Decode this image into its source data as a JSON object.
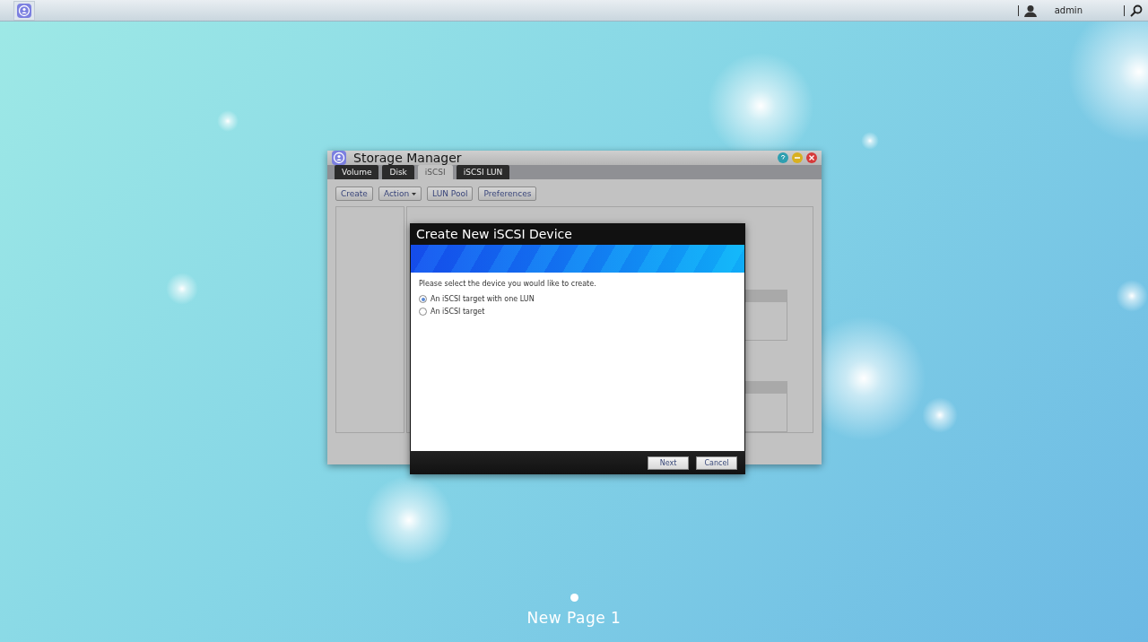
{
  "top_bar": {
    "user": "admin"
  },
  "window": {
    "title": "Storage Manager",
    "tabs": [
      {
        "label": "Volume",
        "selected": false
      },
      {
        "label": "Disk",
        "selected": false
      },
      {
        "label": "iSCSI",
        "selected": true
      },
      {
        "label": "iSCSI LUN",
        "selected": false
      }
    ],
    "toolbar": [
      {
        "label": "Create",
        "kind": "button"
      },
      {
        "label": "Action",
        "kind": "menu"
      },
      {
        "label": "LUN Pool",
        "kind": "button"
      },
      {
        "label": "Preferences",
        "kind": "button"
      }
    ]
  },
  "dialog": {
    "title": "Create New iSCSI Device",
    "prompt": "Please select the device you would like to create.",
    "options": [
      {
        "label": "An iSCSI target with one LUN",
        "selected": true
      },
      {
        "label": "An iSCSI target",
        "selected": false
      }
    ],
    "buttons": [
      "Next",
      "Cancel"
    ]
  },
  "page_label": "New Page 1"
}
